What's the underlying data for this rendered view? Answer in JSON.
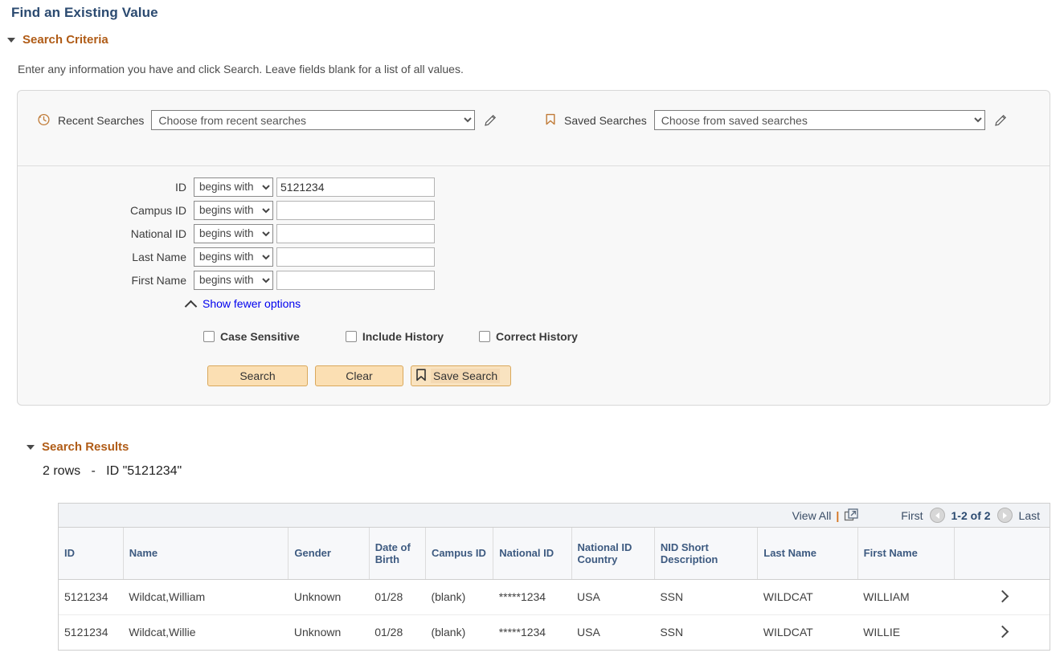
{
  "page": {
    "title": "Find an Existing Value"
  },
  "search_criteria": {
    "section_label": "Search Criteria",
    "instructions": "Enter any information you have and click Search. Leave fields blank for a list of all values.",
    "recent_searches_label": "Recent Searches",
    "recent_searches_value": "Choose from recent searches",
    "recent_searches_edit_icon": "pencil-icon",
    "recent_searches_icon": "history-clock-icon",
    "saved_searches_label": "Saved Searches",
    "saved_searches_value": "Choose from saved searches",
    "saved_searches_edit_icon": "pencil-icon",
    "saved_searches_icon": "bookmark-icon",
    "operator_default": "begins with",
    "fields": [
      {
        "label": "ID",
        "operator": "begins with",
        "value": "5121234"
      },
      {
        "label": "Campus ID",
        "operator": "begins with",
        "value": ""
      },
      {
        "label": "National ID",
        "operator": "begins with",
        "value": ""
      },
      {
        "label": "Last Name",
        "operator": "begins with",
        "value": ""
      },
      {
        "label": "First Name",
        "operator": "begins with",
        "value": ""
      }
    ],
    "show_fewer_options": "Show fewer options",
    "checkboxes": [
      {
        "label": "Case Sensitive",
        "checked": false
      },
      {
        "label": "Include History",
        "checked": false
      },
      {
        "label": "Correct History",
        "checked": false
      }
    ],
    "buttons": {
      "search": "Search",
      "clear": "Clear",
      "save_search": "Save Search",
      "save_search_icon": "bookmark-icon"
    }
  },
  "search_results": {
    "section_label": "Search Results",
    "count_text": "2 rows   -   ID \"5121234\"",
    "toolbar": {
      "view_all": "View All",
      "separator": "|",
      "new_window_icon": "open-in-new-window-icon",
      "first": "First",
      "prev_icon": "triangle-left-icon",
      "range": "1-2 of 2",
      "next_icon": "triangle-right-icon",
      "last": "Last"
    },
    "columns": [
      "ID",
      "Name",
      "Gender",
      "Date of Birth",
      "Campus ID",
      "National ID",
      "National ID Country",
      "NID Short Description",
      "Last Name",
      "First Name",
      ""
    ],
    "rows": [
      {
        "id": "5121234",
        "name": "Wildcat,William",
        "gender": "Unknown",
        "dob": "01/28",
        "campus_id": "(blank)",
        "national_id": "*****1234",
        "national_id_country": "USA",
        "nid_short_description": "SSN",
        "last_name": "WILDCAT",
        "first_name": "WILLIAM",
        "arrow_icon": "chevron-right-icon"
      },
      {
        "id": "5121234",
        "name": "Wildcat,Willie",
        "gender": "Unknown",
        "dob": "01/28",
        "campus_id": "(blank)",
        "national_id": "*****1234",
        "national_id_country": "USA",
        "nid_short_description": "SSN",
        "last_name": "WILDCAT",
        "first_name": "WILLIE",
        "arrow_icon": "chevron-right-icon"
      }
    ]
  },
  "colors": {
    "title": "#2b4a70",
    "section_heading": "#b05c17",
    "link": "#0000ee",
    "button_bg": "#fbdfb3",
    "button_border": "#d9a85c",
    "panel_bg": "#f8f8f8",
    "grid_header_text": "#3d5a80",
    "accent_orange": "#d4711a"
  }
}
